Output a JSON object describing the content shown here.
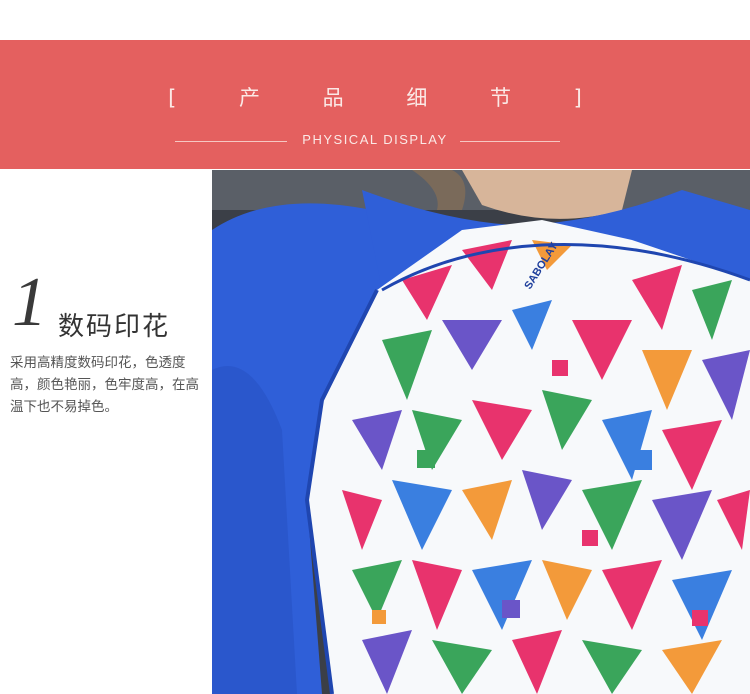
{
  "header": {
    "title": "[ 产 品 细 节 ]",
    "subtitle": "PHYSICAL DISPLAY"
  },
  "feature": {
    "number": "1",
    "title": "数码印花",
    "description": "采用高精度数码印花，色透度高，颜色艳丽，色牢度高，在高温下也不易掉色。"
  },
  "photo": {
    "brand_print": "SABOLAY",
    "colors": {
      "sleeve": "#2f5fd8",
      "fabric": "#f7f9fb",
      "background": "#3b3f47"
    }
  }
}
